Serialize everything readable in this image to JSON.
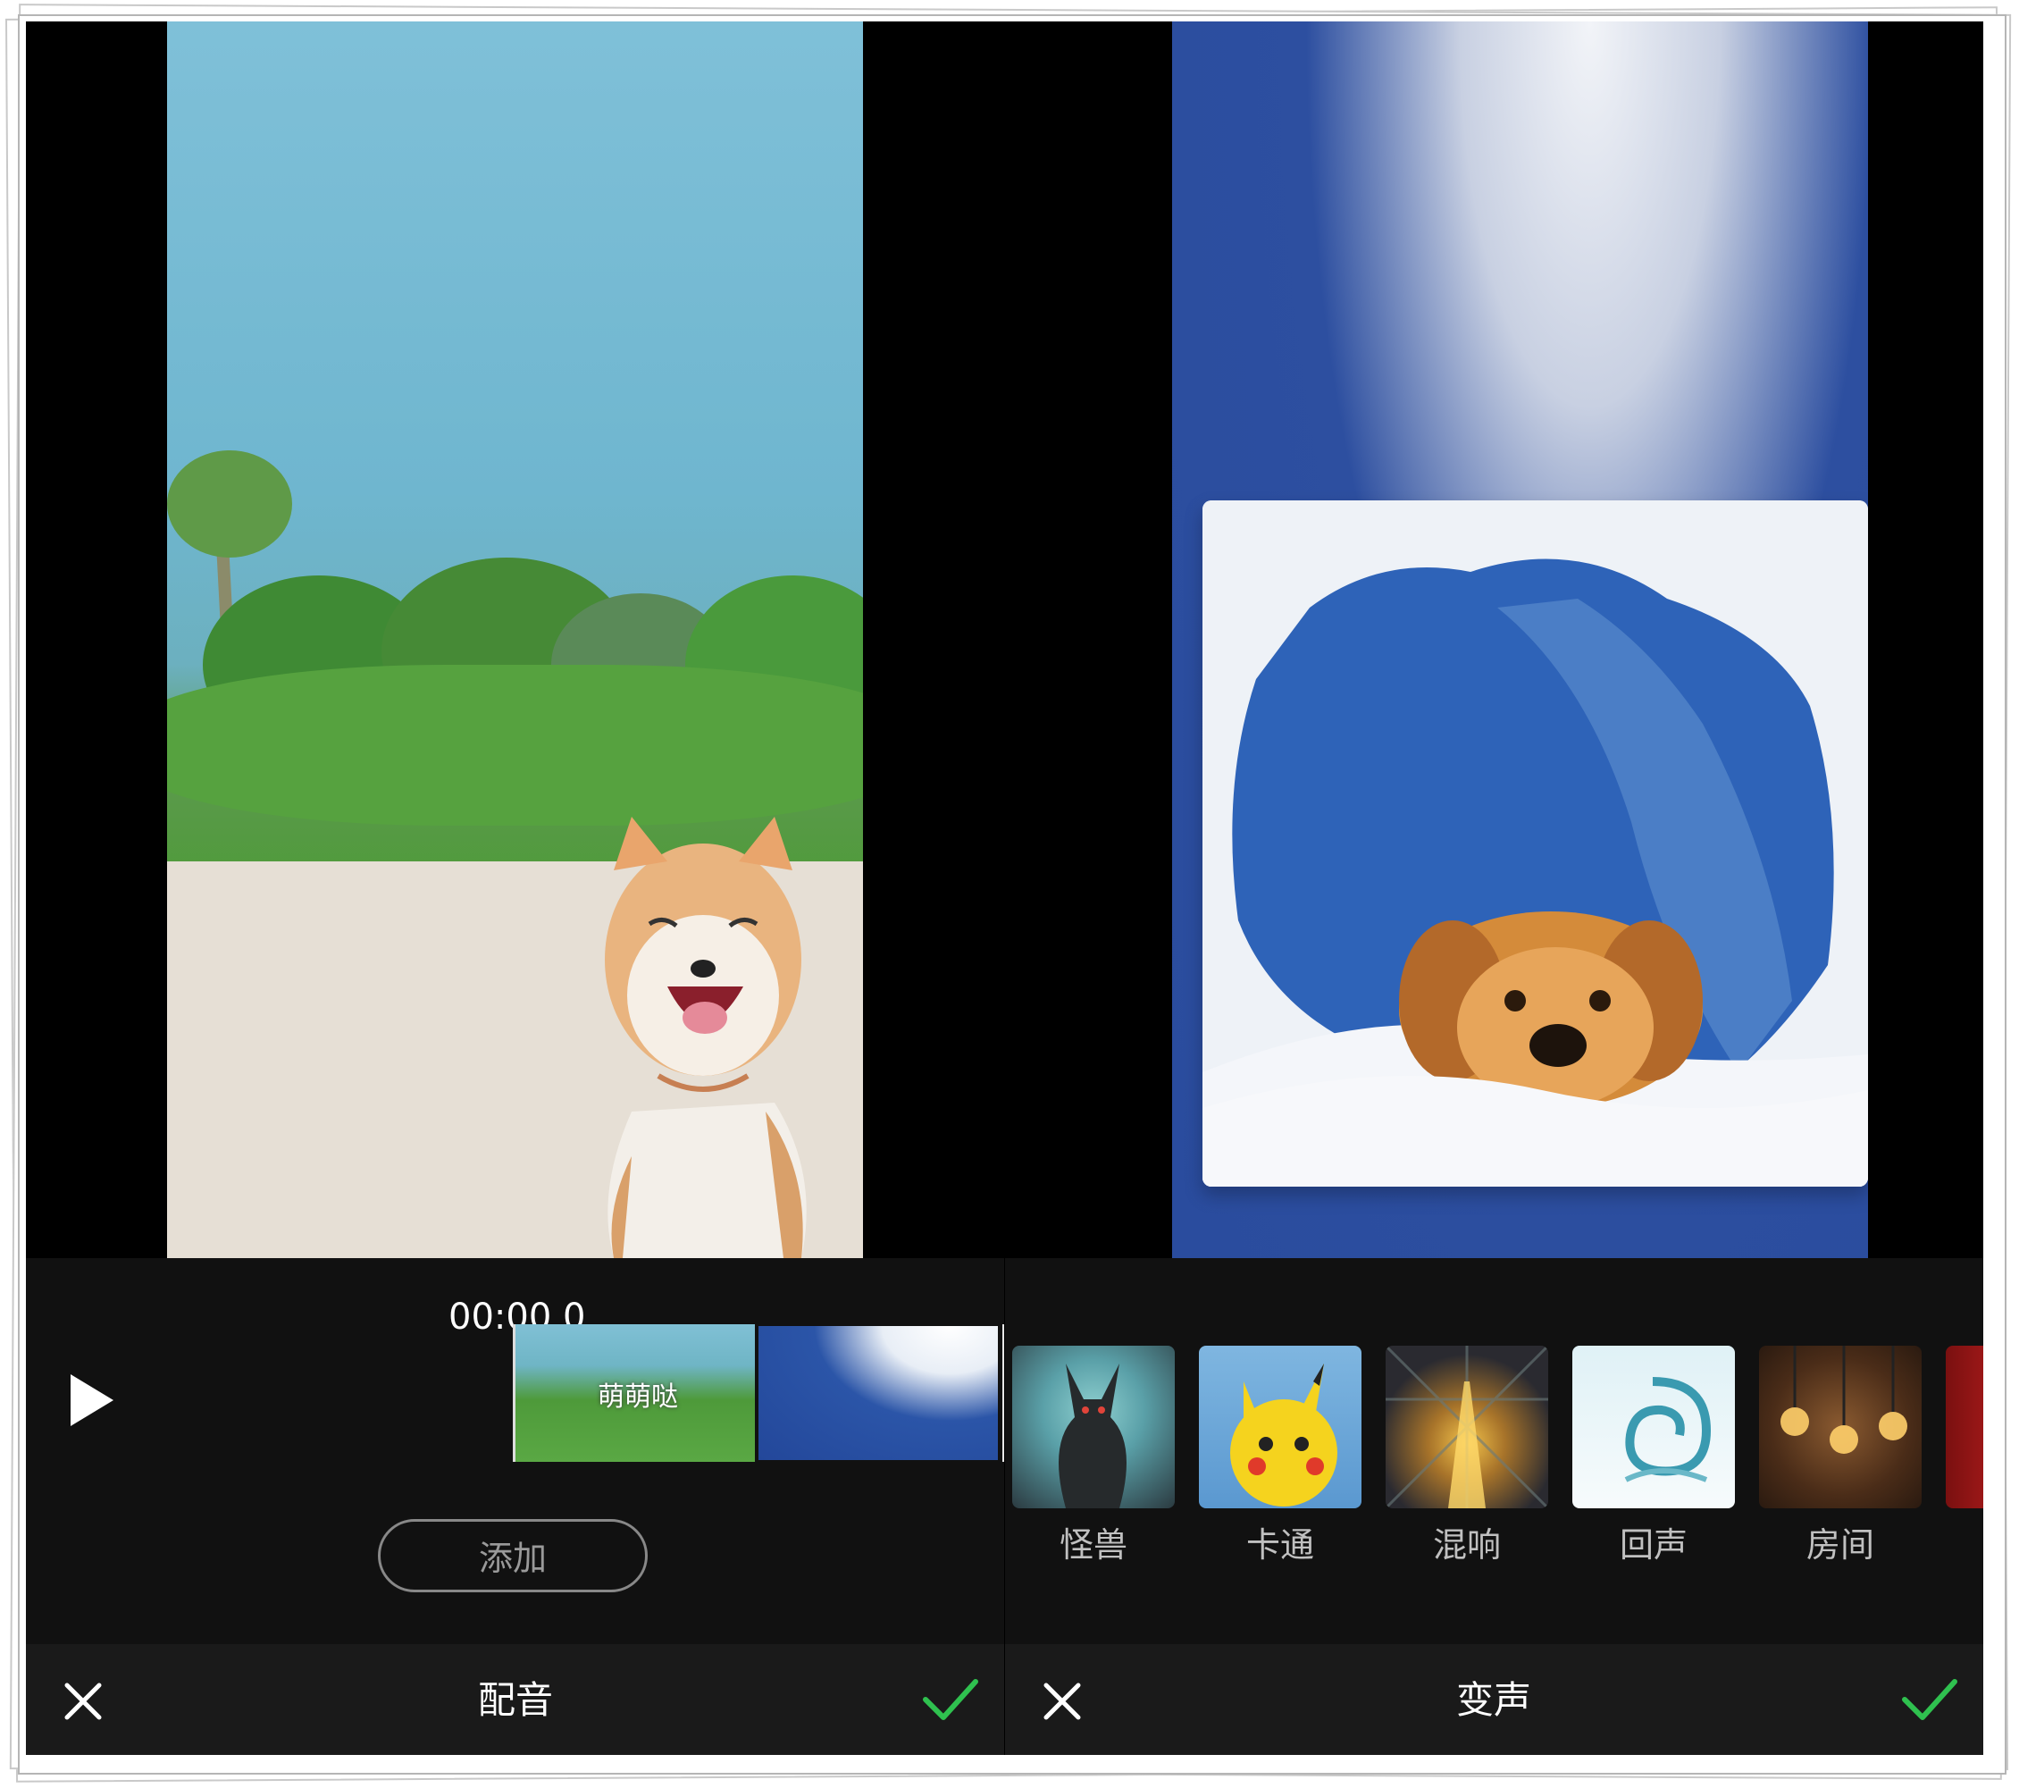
{
  "left_panel": {
    "timecode": "00:00.0",
    "timeline_clip_text": "萌萌哒",
    "add_button": "添加",
    "title": "配音"
  },
  "right_panel": {
    "title": "变声",
    "effects": [
      {
        "label": "怪兽"
      },
      {
        "label": "卡通"
      },
      {
        "label": "混响"
      },
      {
        "label": "回声"
      },
      {
        "label": "房间"
      }
    ]
  },
  "colors": {
    "accent_check": "#2fc14f",
    "background": "#111111",
    "bottom_bar": "#1a1a1a"
  },
  "icons": {
    "play": "play-icon",
    "close": "close-icon",
    "confirm": "check-icon"
  }
}
